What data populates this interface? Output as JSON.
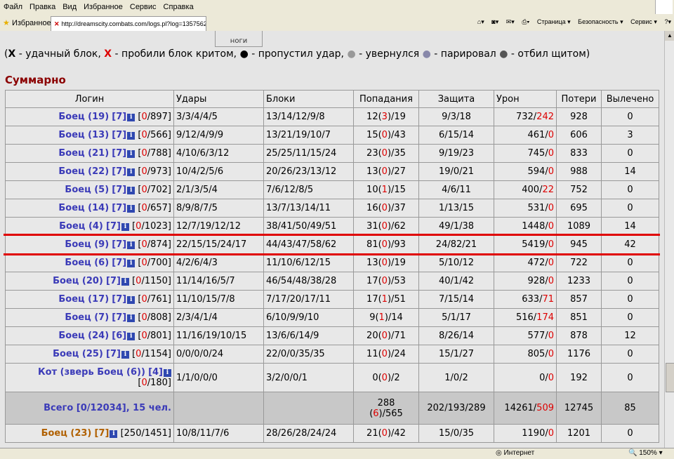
{
  "menu": [
    "Файл",
    "Правка",
    "Вид",
    "Избранное",
    "Сервис",
    "Справка"
  ],
  "toolbar": {
    "favorites": "Избранное",
    "tab_url": "http://dreamscity.combats.com/logs.pl?log=1357562...",
    "page": "Страница ▾",
    "security": "Безопасность ▾",
    "service": "Сервис ▾"
  },
  "prev_cell": "ноги",
  "legend": {
    "open": "(",
    "x1": "X",
    "t1": " - удачный блок, ",
    "x2": "X",
    "t2": " - пробили блок критом, ",
    "d1": "●",
    "t3": " - пропустил удар, ",
    "d2": "●",
    "t4": " - увернулся ",
    "d3": "●",
    "t5": " - парировал ",
    "d4": "●",
    "t6": " - отбил щитом)"
  },
  "summary_title": "Суммарно",
  "columns": [
    "Логин",
    "Удары",
    "Блоки",
    "Попадания",
    "Защита",
    "Урон",
    "Потери",
    "Вылечено"
  ],
  "rows": [
    {
      "name": "Боец (19)",
      "lvl": "[7]",
      "hp_a": "0",
      "hp_b": "/897]",
      "hits": "3/3/4/4/5",
      "blocks": "13/14/12/9/8",
      "p1": "12(",
      "p2": "3",
      "p3": ")/19",
      "def": "9/3/18",
      "d1": "732/",
      "d2": "242",
      "loss": "928",
      "heal": "0"
    },
    {
      "name": "Боец (13)",
      "lvl": "[7]",
      "hp_a": "0",
      "hp_b": "/566]",
      "hits": "9/12/4/9/9",
      "blocks": "13/21/19/10/7",
      "p1": "15(",
      "p2": "0",
      "p3": ")/43",
      "def": "6/15/14",
      "d1": "461/",
      "d2": "0",
      "loss": "606",
      "heal": "3"
    },
    {
      "name": "Боец (21)",
      "lvl": "[7]",
      "hp_a": "0",
      "hp_b": "/788]",
      "hits": "4/10/6/3/12",
      "blocks": "25/25/11/15/24",
      "p1": "23(",
      "p2": "0",
      "p3": ")/35",
      "def": "9/19/23",
      "d1": "745/",
      "d2": "0",
      "loss": "833",
      "heal": "0"
    },
    {
      "name": "Боец (22)",
      "lvl": "[7]",
      "hp_a": "0",
      "hp_b": "/973]",
      "hits": "10/4/2/5/6",
      "blocks": "20/26/23/13/12",
      "p1": "13(",
      "p2": "0",
      "p3": ")/27",
      "def": "19/0/21",
      "d1": "594/",
      "d2": "0",
      "loss": "988",
      "heal": "14"
    },
    {
      "name": "Боец (5)",
      "lvl": "[7]",
      "hp_a": "0",
      "hp_b": "/702]",
      "hits": "2/1/3/5/4",
      "blocks": "7/6/12/8/5",
      "p1": "10(",
      "p2": "1",
      "p3": ")/15",
      "def": "4/6/11",
      "d1": "400/",
      "d2": "22",
      "loss": "752",
      "heal": "0"
    },
    {
      "name": "Боец (14)",
      "lvl": "[7]",
      "hp_a": "0",
      "hp_b": "/657]",
      "hits": "8/9/8/7/5",
      "blocks": "13/7/13/14/11",
      "p1": "16(",
      "p2": "0",
      "p3": ")/37",
      "def": "1/13/15",
      "d1": "531/",
      "d2": "0",
      "loss": "695",
      "heal": "0"
    },
    {
      "name": "Боец (4)",
      "lvl": "[7]",
      "hp_a": "0",
      "hp_b": "/1023]",
      "hits": "12/7/19/12/12",
      "blocks": "38/41/50/49/51",
      "p1": "31(",
      "p2": "0",
      "p3": ")/62",
      "def": "49/1/38",
      "d1": "1448/",
      "d2": "0",
      "loss": "1089",
      "heal": "14"
    },
    {
      "name": "Боец (9)",
      "lvl": "[7]",
      "hp_a": "0",
      "hp_b": "/874]",
      "hits": "22/15/15/24/17",
      "blocks": "44/43/47/58/62",
      "p1": "81(",
      "p2": "0",
      "p3": ")/93",
      "def": "24/82/21",
      "d1": "5419/",
      "d2": "0",
      "loss": "945",
      "heal": "42"
    },
    {
      "name": "Боец (6)",
      "lvl": "[7]",
      "hp_a": "0",
      "hp_b": "/700]",
      "hits": "4/2/6/4/3",
      "blocks": "11/10/6/12/15",
      "p1": "13(",
      "p2": "0",
      "p3": ")/19",
      "def": "5/10/12",
      "d1": "472/",
      "d2": "0",
      "loss": "722",
      "heal": "0"
    },
    {
      "name": "Боец (20)",
      "lvl": "[7]",
      "hp_a": "0",
      "hp_b": "/1150]",
      "hits": "11/14/16/5/7",
      "blocks": "46/54/48/38/28",
      "p1": "17(",
      "p2": "0",
      "p3": ")/53",
      "def": "40/1/42",
      "d1": "928/",
      "d2": "0",
      "loss": "1233",
      "heal": "0"
    },
    {
      "name": "Боец (17)",
      "lvl": "[7]",
      "hp_a": "0",
      "hp_b": "/761]",
      "hits": "11/10/15/7/8",
      "blocks": "7/17/20/17/11",
      "p1": "17(",
      "p2": "1",
      "p3": ")/51",
      "def": "7/15/14",
      "d1": "633/",
      "d2": "71",
      "loss": "857",
      "heal": "0"
    },
    {
      "name": "Боец (7)",
      "lvl": "[7]",
      "hp_a": "0",
      "hp_b": "/808]",
      "hits": "2/3/4/1/4",
      "blocks": "6/10/9/9/10",
      "p1": "9(",
      "p2": "1",
      "p3": ")/14",
      "def": "5/1/17",
      "d1": "516/",
      "d2": "174",
      "loss": "851",
      "heal": "0"
    },
    {
      "name": "Боец (24)",
      "lvl": "[6]",
      "hp_a": "0",
      "hp_b": "/801]",
      "hits": "11/16/19/10/15",
      "blocks": "13/6/6/14/9",
      "p1": "20(",
      "p2": "0",
      "p3": ")/71",
      "def": "8/26/14",
      "d1": "577/",
      "d2": "0",
      "loss": "878",
      "heal": "12"
    },
    {
      "name": "Боец (25)",
      "lvl": "[7]",
      "hp_a": "0",
      "hp_b": "/1154]",
      "hits": "0/0/0/0/24",
      "blocks": "22/0/0/35/35",
      "p1": "11(",
      "p2": "0",
      "p3": ")/24",
      "def": "15/1/27",
      "d1": "805/",
      "d2": "0",
      "loss": "1176",
      "heal": "0"
    }
  ],
  "pet_row": {
    "name": "Кот (зверь Боец (6))",
    "lvl": "[4]",
    "hp_a": "0",
    "hp_b": "/180]",
    "hits": "1/1/0/0/0",
    "blocks": "3/2/0/0/1",
    "p1": "0(",
    "p2": "0",
    "p3": ")/2",
    "def": "1/0/2",
    "d1": "0/",
    "d2": "0",
    "loss": "192",
    "heal": "0"
  },
  "total_row": {
    "label": "Всего [0/12034], 15 чел.",
    "p1": "288",
    "p2": "(",
    "p3": "6",
    "p4": ")/565",
    "def": "202/193/289",
    "d1": "14261/",
    "d2": "509",
    "loss": "12745",
    "heal": "85"
  },
  "last_row": {
    "name": "Боец (23)",
    "lvl": "[7]",
    "hp_b": "[250/1451]",
    "hits": "10/8/11/7/6",
    "blocks": "28/26/28/24/24",
    "p1": "21(",
    "p2": "0",
    "p3": ")/42",
    "def": "15/0/35",
    "d1": "1190/",
    "d2": "0",
    "loss": "1201",
    "heal": "0"
  },
  "status": {
    "zone": "Интернет",
    "zoom": "150%"
  },
  "colors": {
    "accent_red": "#dd0000",
    "team_blue": "#3b3bb8",
    "team_orange": "#b06000",
    "title": "#8b0000"
  }
}
